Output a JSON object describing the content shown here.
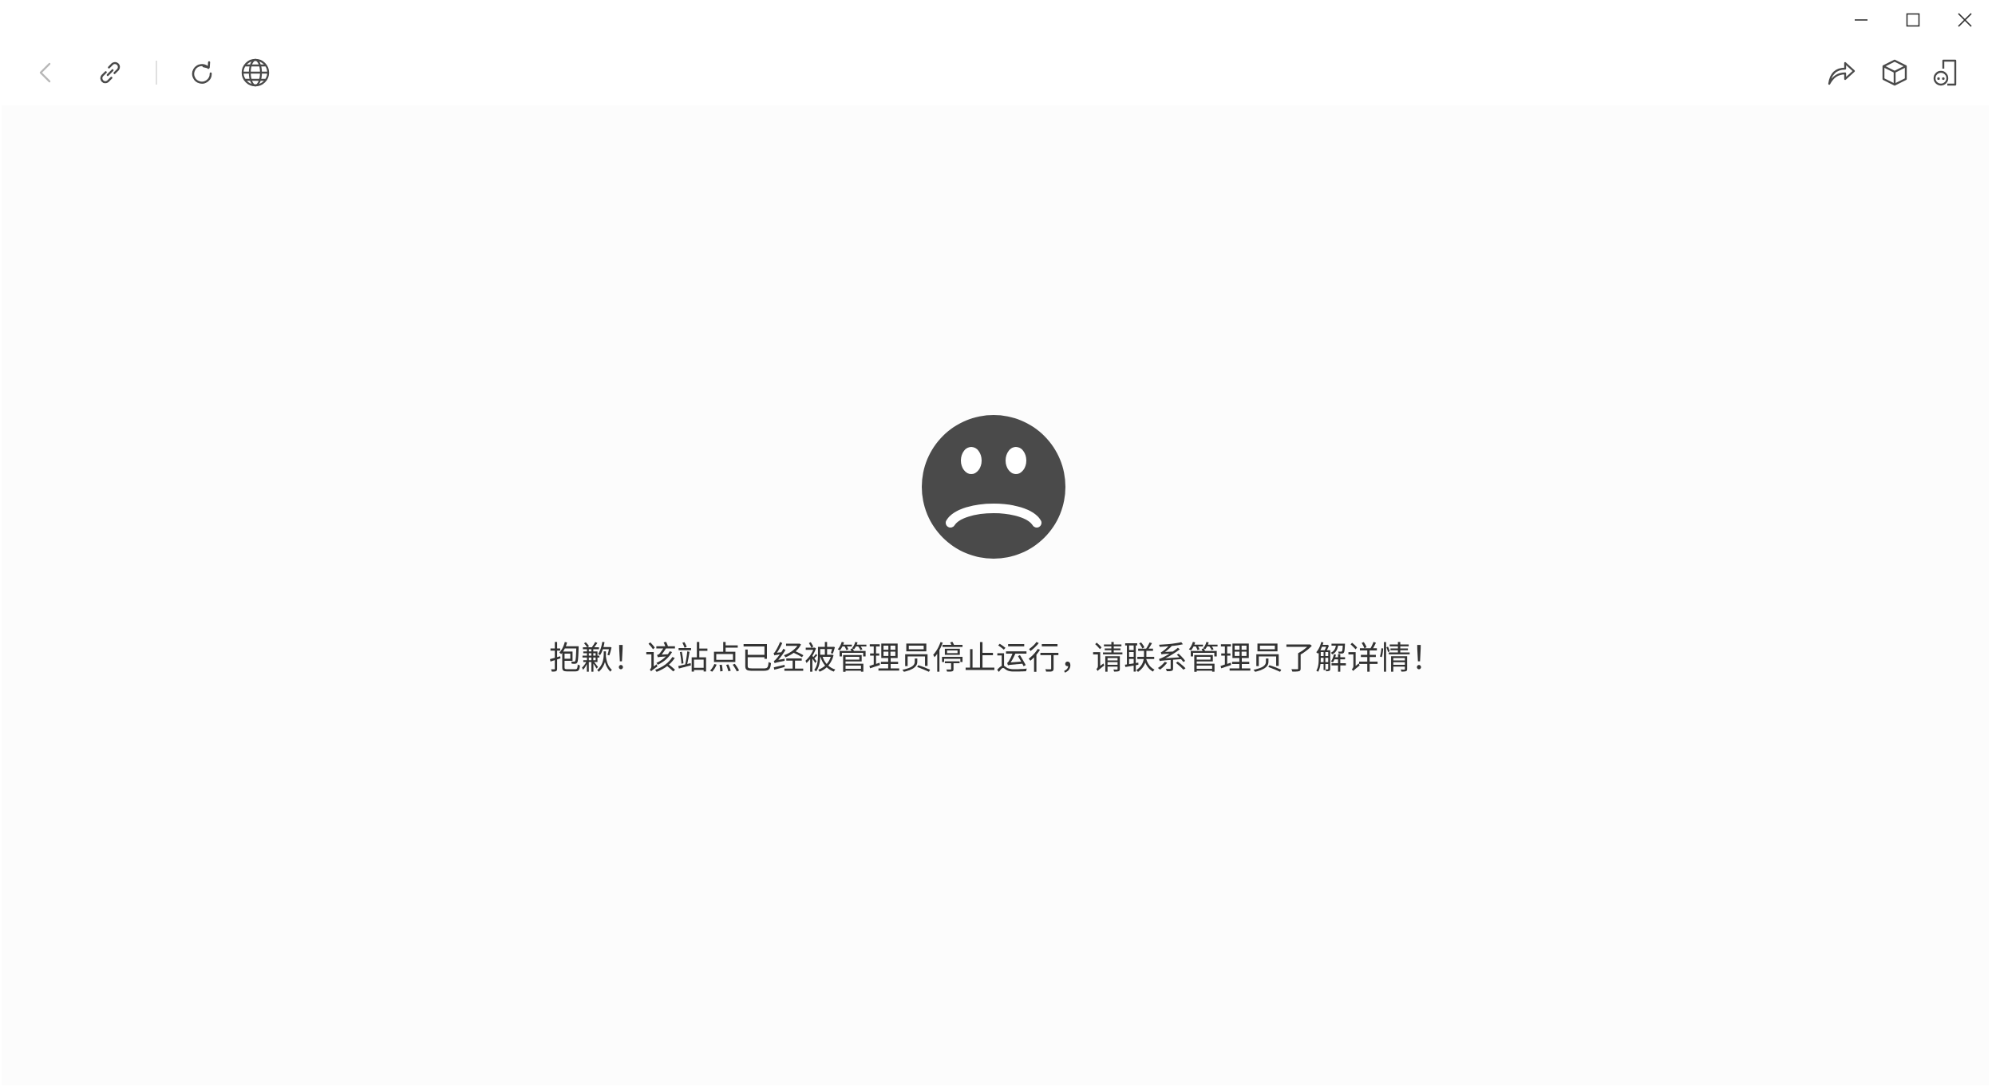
{
  "window_controls": {
    "minimize": "minimize-icon",
    "maximize": "maximize-icon",
    "close": "close-icon"
  },
  "toolbar": {
    "left": [
      "back-icon",
      "link-icon",
      "refresh-icon",
      "globe-icon"
    ],
    "right": [
      "share-icon",
      "cube-icon",
      "device-icon"
    ]
  },
  "error": {
    "icon": "sad-face-icon",
    "message": "抱歉！该站点已经被管理员停止运行，请联系管理员了解详情！"
  },
  "colors": {
    "icon": "#4a4a4a",
    "icon_disabled": "#b8b8b8",
    "face": "#4a4a4a",
    "content_bg": "#fcfcfc"
  }
}
